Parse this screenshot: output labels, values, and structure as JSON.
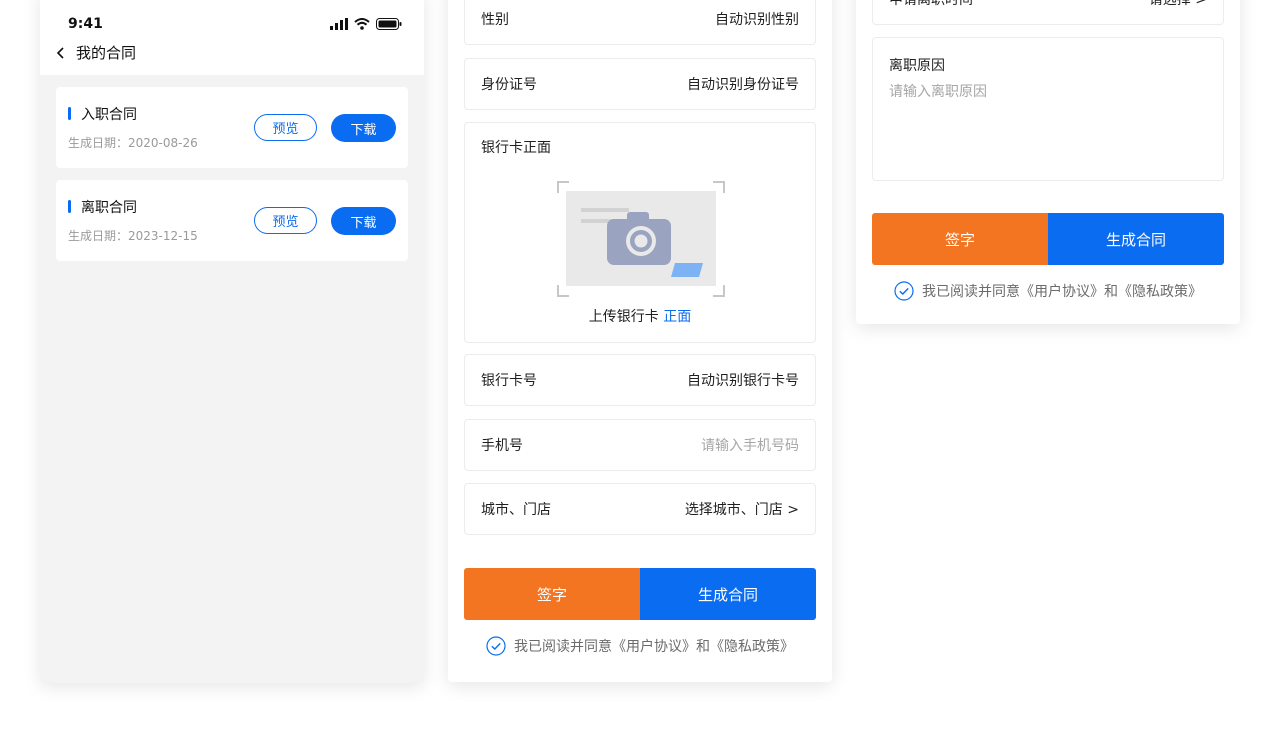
{
  "colors": {
    "accent": "#0a6cf0",
    "orange": "#f47521",
    "background": "#f3f3f3",
    "placeholder": "#a6a6a6"
  },
  "screen1": {
    "status": {
      "time": "9:41",
      "icons": [
        "signal-icon",
        "wifi-icon",
        "battery-icon"
      ]
    },
    "nav": {
      "back_icon": "chevron-left-icon",
      "title": "我的合同"
    },
    "contracts": [
      {
        "title": "入职合同",
        "date": "生成日期：2020-08-26",
        "preview_label": "预览",
        "download_label": "下载"
      },
      {
        "title": "离职合同",
        "date": "生成日期：2023-12-15",
        "preview_label": "预览",
        "download_label": "下载"
      }
    ]
  },
  "screen2": {
    "rows_top": [
      {
        "label": "性别",
        "value": "自动识别性别"
      },
      {
        "label": "身份证号",
        "value": "自动识别身份证号"
      }
    ],
    "bank_upload": {
      "title": "银行卡正面",
      "caption_prefix": "上传银行卡 ",
      "caption_highlight": "正面",
      "icon": "camera-icon"
    },
    "rows_bottom": [
      {
        "label": "银行卡号",
        "value": "自动识别银行卡号",
        "placeholder": false
      },
      {
        "label": "手机号",
        "value": "请输入手机号码",
        "placeholder": true
      },
      {
        "label": "城市、门店",
        "value": "选择城市、门店 >",
        "placeholder": false
      }
    ],
    "actions": {
      "sign": "签字",
      "generate": "生成合同"
    },
    "agreement": "我已阅读并同意《用户协议》和《隐私政策》"
  },
  "screen3": {
    "apply_time_row": {
      "label": "申请离职时间",
      "value": "请选择 >"
    },
    "reason": {
      "label": "离职原因",
      "placeholder": "请输入离职原因"
    },
    "actions": {
      "sign": "签字",
      "generate": "生成合同"
    },
    "agreement": "我已阅读并同意《用户协议》和《隐私政策》"
  }
}
